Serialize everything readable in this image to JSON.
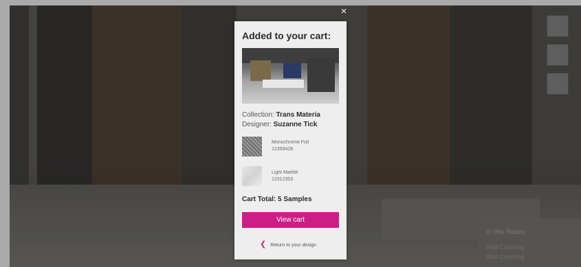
{
  "modal": {
    "title": "Added to your cart:",
    "collection_label": "Collection:",
    "collection_value": "Trans Materia",
    "designer_label": "Designer:",
    "designer_value": "Suzanne Tick",
    "items": [
      {
        "name": "Monochrome Foil",
        "code": "12359428"
      },
      {
        "name": "Light Marble",
        "code": "12312353"
      }
    ],
    "cart_total": "Cart Total: 5 Samples",
    "view_cart_label": "View cart",
    "return_label": "Return to your design"
  },
  "close_glyph": "×",
  "background_panel": {
    "title": "In this Room",
    "line1": "Wall Covering",
    "line2": "Wall Covering"
  },
  "colors": {
    "accent": "#cc1f86"
  },
  "icons": [
    "close-icon",
    "chevron-left-icon"
  ]
}
